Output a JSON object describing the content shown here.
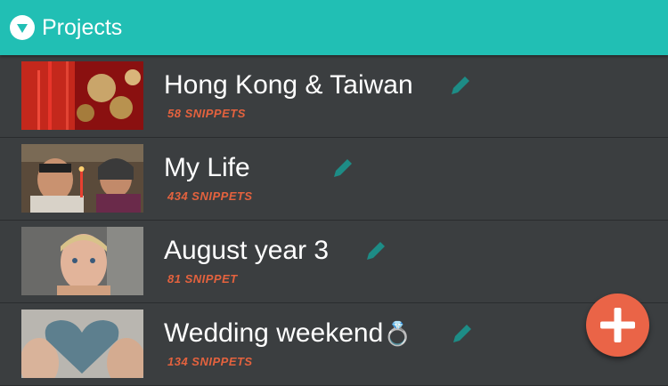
{
  "header": {
    "title": "Projects",
    "menu_icon": "chevron-down-circle-icon"
  },
  "colors": {
    "accent": "#21bfb4",
    "background": "#3b3e40",
    "count_text": "#e4623e",
    "fab": "#ea6447",
    "edit_icon": "#1d8c86"
  },
  "projects": [
    {
      "title": "Hong Kong & Taiwan",
      "count": "58 SNIPPETS",
      "thumbnail": "red ornaments photo"
    },
    {
      "title": "My Life",
      "count": "434 SNIPPETS",
      "thumbnail": "couple with candle photo"
    },
    {
      "title": "August year 3",
      "count": "81 SNIPPET",
      "thumbnail": "child portrait photo"
    },
    {
      "title": "Wedding weekend",
      "title_emoji": "💍",
      "count": "134 SNIPPETS",
      "thumbnail": "felt heart photo"
    }
  ],
  "fab": {
    "icon": "plus-icon"
  }
}
